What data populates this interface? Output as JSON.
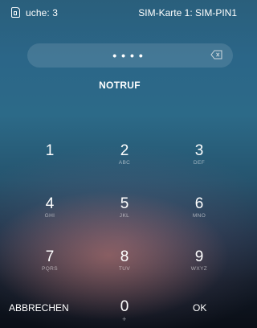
{
  "status": {
    "left_text": "uche: 3",
    "right_text": "SIM-Karte 1: SIM-PIN1"
  },
  "pin": {
    "masked": "••••"
  },
  "emergency_label": "NOTRUF",
  "keys": [
    {
      "num": "1",
      "sub": ""
    },
    {
      "num": "2",
      "sub": "ABC"
    },
    {
      "num": "3",
      "sub": "DEF"
    },
    {
      "num": "4",
      "sub": "GHI"
    },
    {
      "num": "5",
      "sub": "JKL"
    },
    {
      "num": "6",
      "sub": "MNO"
    },
    {
      "num": "7",
      "sub": "PQRS"
    },
    {
      "num": "8",
      "sub": "TUV"
    },
    {
      "num": "9",
      "sub": "WXYZ"
    },
    {
      "num": "0",
      "sub": "+"
    }
  ],
  "actions": {
    "cancel": "ABBRECHEN",
    "ok": "OK"
  },
  "icons": {
    "sim": "sim-card-icon",
    "delete": "backspace-icon"
  }
}
